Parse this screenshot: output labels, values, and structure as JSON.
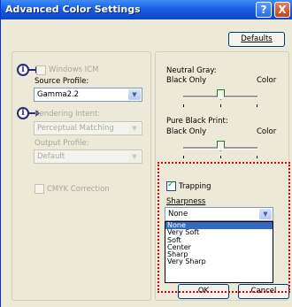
{
  "window": {
    "title": "Advanced Color Settings",
    "help_label": "?",
    "close_label": "X",
    "defaults_label": "Defaults"
  },
  "left": {
    "windows_icm_label": "Windows ICM",
    "source_profile_label": "Source Profile:",
    "source_profile_value": "Gamma2.2",
    "rendering_intent_label": "Rendering Intent:",
    "rendering_intent_value": "Perceptual Matching",
    "output_profile_label": "Output Profile:",
    "output_profile_value": "Default",
    "cmyk_label": "CMYK Correction",
    "info_glyph": "i"
  },
  "right": {
    "neutral_gray_label": "Neutral Gray:",
    "neutral_left": "Black Only",
    "neutral_right": "Color",
    "pure_black_label": "Pure Black Print:",
    "pure_left": "Black Only",
    "pure_right": "Color",
    "trapping_label": "Trapping",
    "sharpness_label": "Sharpness",
    "sharpness_value": "None",
    "sharpness_options": [
      "None",
      "Very Soft",
      "Soft",
      "Center",
      "Sharp",
      "Very Sharp"
    ]
  },
  "buttons": {
    "ok": "OK",
    "cancel": "Cancel"
  },
  "colors": {
    "highlight": "#e00000",
    "selection": "#316ac5",
    "title_bar": "#0c47c8"
  }
}
